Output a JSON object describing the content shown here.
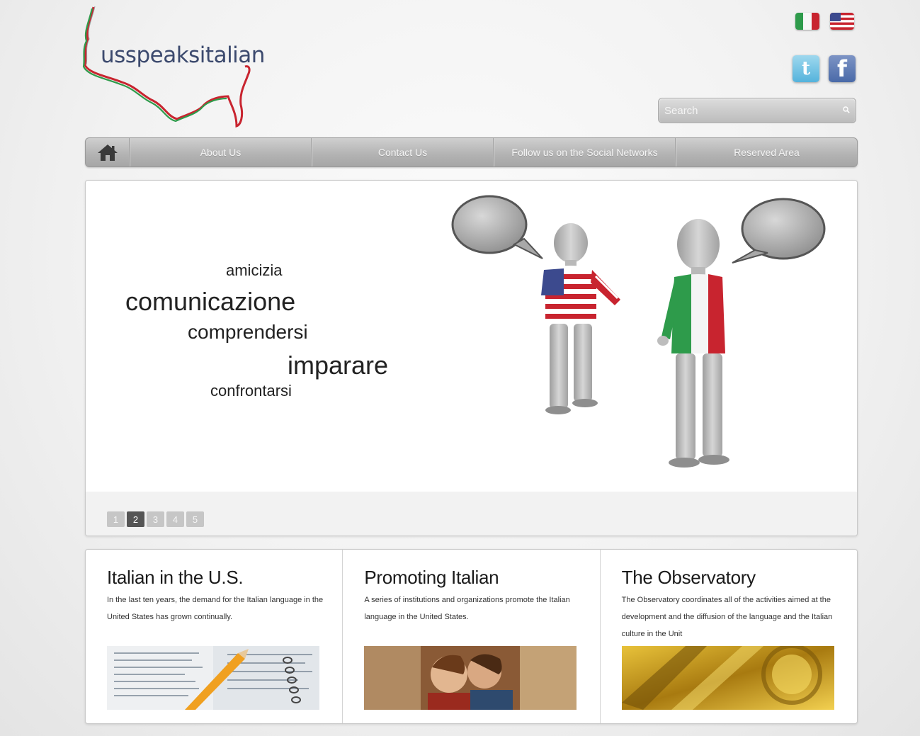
{
  "header": {
    "logo_text": "usspeaksitalian",
    "search_placeholder": "Search",
    "languages": [
      {
        "name": "italian-flag-icon",
        "code": "it"
      },
      {
        "name": "us-flag-icon",
        "code": "en"
      }
    ],
    "social": {
      "twitter_glyph": "t",
      "facebook_glyph": "f"
    }
  },
  "nav": {
    "home_icon": "home-icon",
    "items": [
      {
        "label": "About Us"
      },
      {
        "label": "Contact Us"
      },
      {
        "label": "Follow us on the Social Networks"
      },
      {
        "label": "Reserved Area"
      }
    ]
  },
  "slider": {
    "words": [
      "amicizia",
      "comunicazione",
      "comprendersi",
      "imparare",
      "confrontarsi"
    ],
    "pages": [
      "1",
      "2",
      "3",
      "4",
      "5"
    ],
    "active_page": 2
  },
  "boxes": [
    {
      "title": "Italian in the U.S.",
      "text": "In the last ten years, the demand for the Italian language in the United States has grown continually."
    },
    {
      "title": "Promoting Italian",
      "text": "A series of institutions and organizations promote the Italian language in the United States."
    },
    {
      "title": "The Observatory",
      "text": "The Observatory coordinates all of the activities aimed at the development and the diffusion of the language and the Italian culture in the Unit"
    }
  ],
  "colors": {
    "logo_text": "#3c4a6e",
    "nav_bg": "#b2b2b2",
    "accent_green": "#2e9b4b",
    "accent_red": "#c8242f"
  }
}
